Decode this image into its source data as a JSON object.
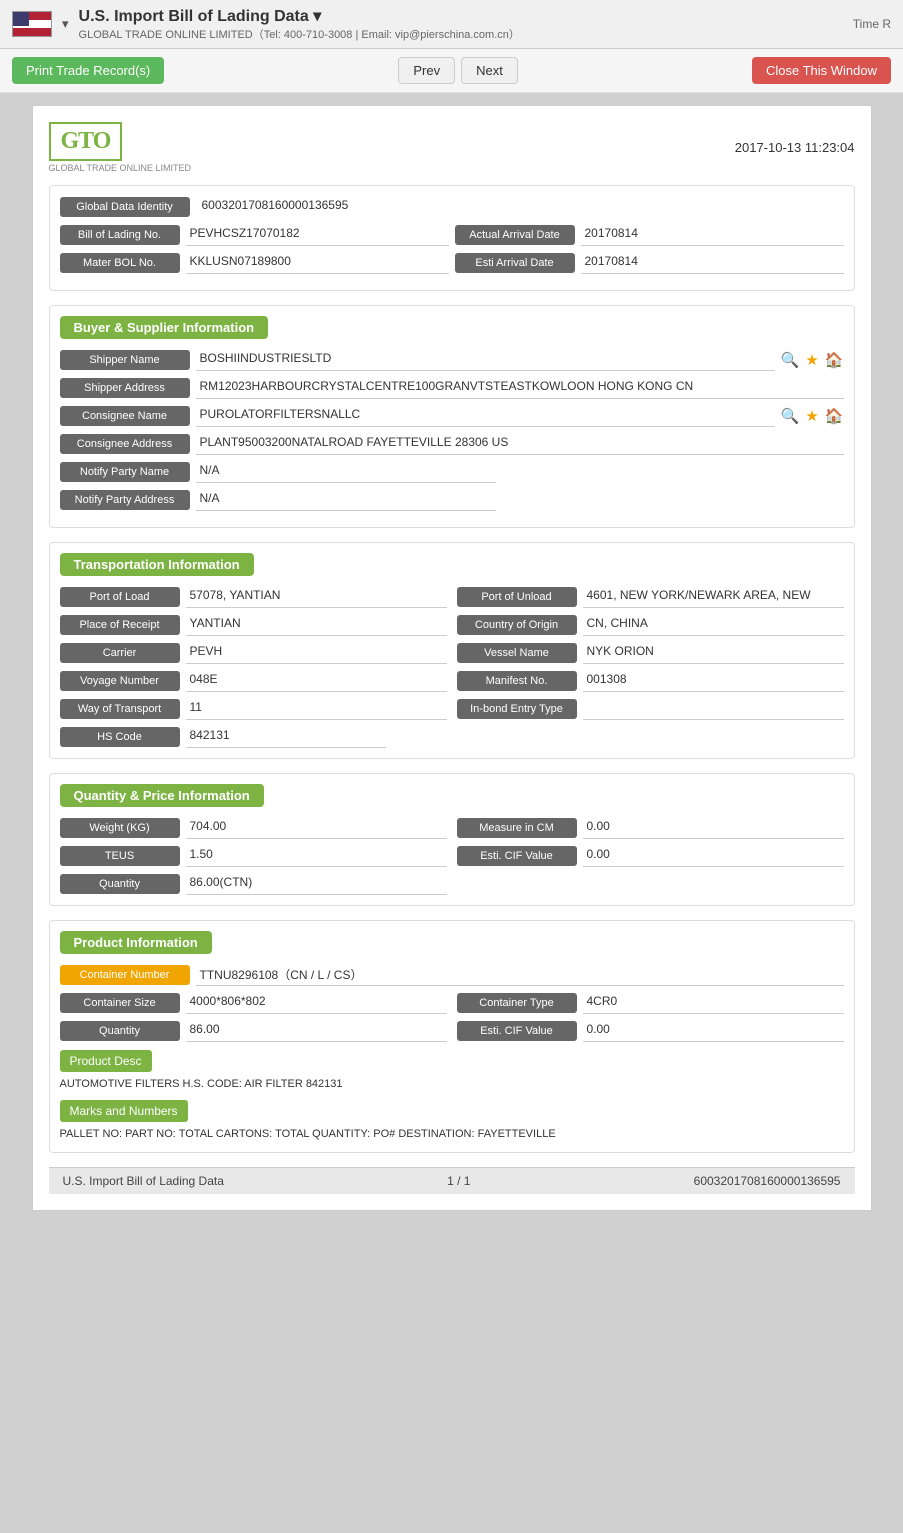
{
  "topbar": {
    "title": "U.S. Import Bill of Lading Data ▾",
    "subtitle": "GLOBAL TRADE ONLINE LIMITED（Tel: 400-710-3008 | Email: vip@pierschina.com.cn）",
    "time_label": "Time R"
  },
  "toolbar": {
    "print_label": "Print Trade Record(s)",
    "prev_label": "Prev",
    "next_label": "Next",
    "close_label": "Close This Window"
  },
  "logo": {
    "company": "GLOBAL TRADE ONLINE LIMITED",
    "datetime": "2017-10-13 11:23:04"
  },
  "global_data": {
    "label": "Global Data Identity",
    "value": "6003201708160000136595"
  },
  "bol": {
    "label": "Bill of Lading No.",
    "value": "PEVHCSZ17070182",
    "actual_arrival_label": "Actual Arrival Date",
    "actual_arrival_value": "20170814"
  },
  "master_bol": {
    "label": "Mater BOL No.",
    "value": "KKLUSN07189800",
    "esti_arrival_label": "Esti Arrival Date",
    "esti_arrival_value": "20170814"
  },
  "buyer_supplier": {
    "section_title": "Buyer & Supplier Information",
    "shipper_name_label": "Shipper Name",
    "shipper_name_value": "BOSHIINDUSTRIESLTD",
    "shipper_address_label": "Shipper Address",
    "shipper_address_value": "RM12023HARBOURCRYSTALCENTRE100GRANVTSTEASTKOWLOON HONG KONG CN",
    "consignee_name_label": "Consignee Name",
    "consignee_name_value": "PUROLATORFILTERSNALLC",
    "consignee_address_label": "Consignee Address",
    "consignee_address_value": "PLANT95003200NATALROAD FAYETTEVILLE 28306 US",
    "notify_party_name_label": "Notify Party Name",
    "notify_party_name_value": "N/A",
    "notify_party_address_label": "Notify Party Address",
    "notify_party_address_value": "N/A"
  },
  "transportation": {
    "section_title": "Transportation Information",
    "port_of_load_label": "Port of Load",
    "port_of_load_value": "57078, YANTIAN",
    "port_of_unload_label": "Port of Unload",
    "port_of_unload_value": "4601, NEW YORK/NEWARK AREA, NEW",
    "place_of_receipt_label": "Place of Receipt",
    "place_of_receipt_value": "YANTIAN",
    "country_of_origin_label": "Country of Origin",
    "country_of_origin_value": "CN, CHINA",
    "carrier_label": "Carrier",
    "carrier_value": "PEVH",
    "vessel_name_label": "Vessel Name",
    "vessel_name_value": "NYK ORION",
    "voyage_number_label": "Voyage Number",
    "voyage_number_value": "048E",
    "manifest_no_label": "Manifest No.",
    "manifest_no_value": "001308",
    "way_of_transport_label": "Way of Transport",
    "way_of_transport_value": "11",
    "inbond_entry_label": "In-bond Entry Type",
    "inbond_entry_value": "",
    "hs_code_label": "HS Code",
    "hs_code_value": "842131"
  },
  "quantity_price": {
    "section_title": "Quantity & Price Information",
    "weight_label": "Weight (KG)",
    "weight_value": "704.00",
    "measure_label": "Measure in CM",
    "measure_value": "0.00",
    "teus_label": "TEUS",
    "teus_value": "1.50",
    "esti_cif_label": "Esti. CIF Value",
    "esti_cif_value": "0.00",
    "quantity_label": "Quantity",
    "quantity_value": "86.00(CTN)"
  },
  "product_info": {
    "section_title": "Product Information",
    "container_number_label": "Container Number",
    "container_number_value": "TTNU8296108（CN / L / CS）",
    "container_size_label": "Container Size",
    "container_size_value": "4000*806*802",
    "container_type_label": "Container Type",
    "container_type_value": "4CR0",
    "quantity_label": "Quantity",
    "quantity_value": "86.00",
    "esti_cif_label": "Esti. CIF Value",
    "esti_cif_value": "0.00",
    "product_desc_label": "Product Desc",
    "product_desc_value": "AUTOMOTIVE FILTERS H.S. CODE: AIR FILTER 842131",
    "marks_label": "Marks and Numbers",
    "marks_value": "PALLET NO: PART NO: TOTAL CARTONS: TOTAL QUANTITY: PO# DESTINATION: FAYETTEVILLE"
  },
  "footer": {
    "left": "U.S. Import Bill of Lading Data",
    "center": "1 / 1",
    "right": "6003201708160000136595"
  }
}
